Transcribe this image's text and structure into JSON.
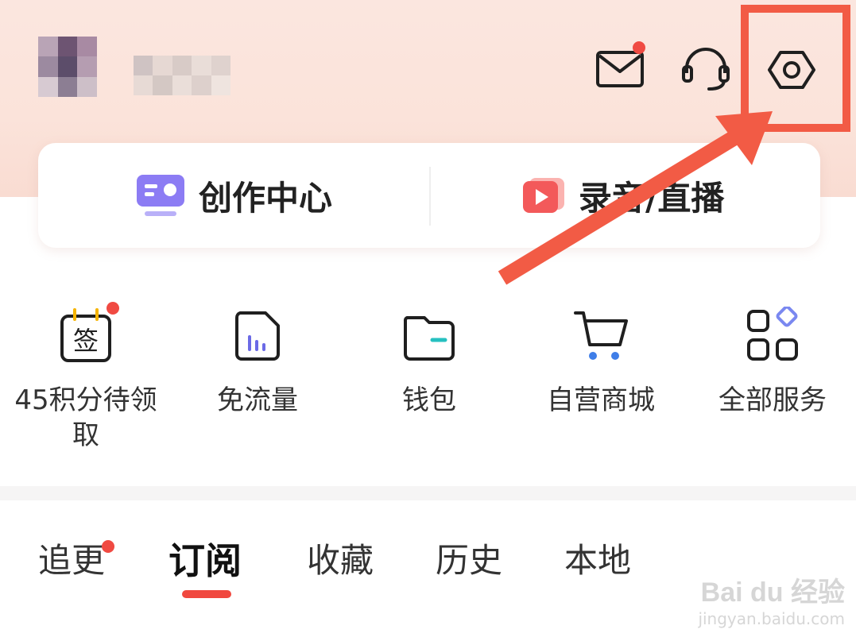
{
  "card": {
    "create_center": "创作中心",
    "record_live": "录音/直播"
  },
  "services": [
    {
      "label": "45积分待领取",
      "icon": "sign-calendar-icon"
    },
    {
      "label": "免流量",
      "icon": "data-sim-icon"
    },
    {
      "label": "钱包",
      "icon": "wallet-icon"
    },
    {
      "label": "自营商城",
      "icon": "shopping-cart-icon"
    },
    {
      "label": "全部服务",
      "icon": "all-services-grid-icon"
    }
  ],
  "sign_icon_char": "签",
  "tabs": [
    {
      "label": "追更",
      "badge": true
    },
    {
      "label": "订阅",
      "active": true
    },
    {
      "label": "收藏"
    },
    {
      "label": "历史"
    },
    {
      "label": "本地"
    }
  ],
  "watermark": {
    "brand": "Bai du 经验",
    "url": "jingyan.baidu.com"
  },
  "colors": {
    "accent_red": "#f04a42",
    "highlight_red": "#f25b45",
    "header_bg": "#fbe4db"
  }
}
